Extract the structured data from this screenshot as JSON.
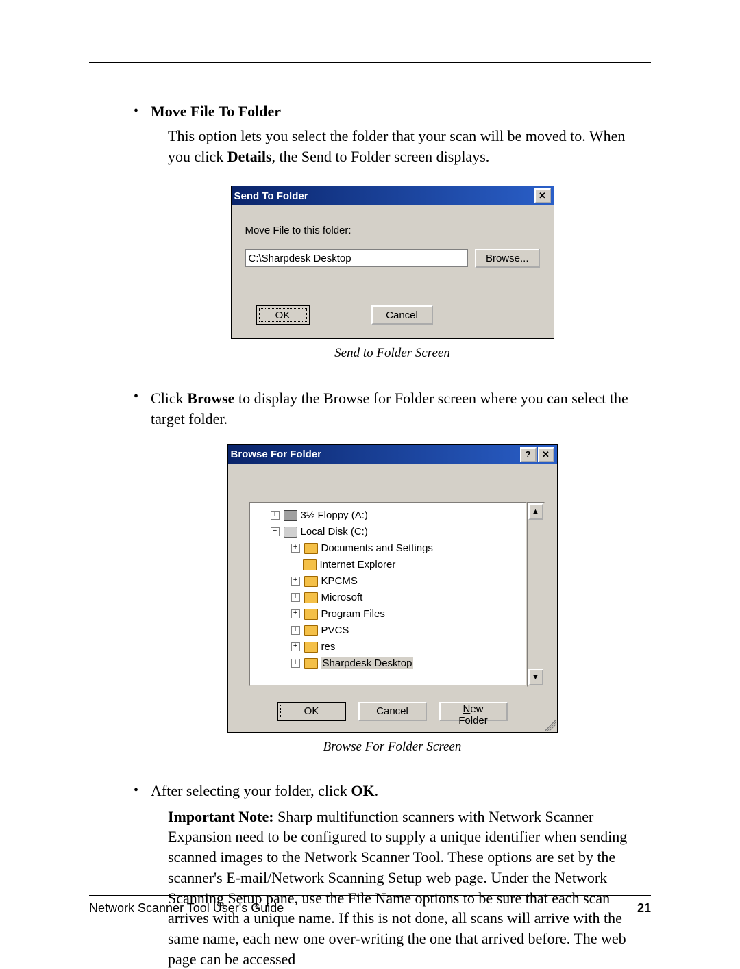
{
  "page": {
    "bullet1_heading": "Move File To Folder",
    "para1_a": "This option lets you select the folder that your scan will be moved to. When you click ",
    "para1_b_bold": "Details",
    "para1_c": ", the Send to Folder screen displays.",
    "caption1": "Send to Folder Screen",
    "bullet2_a": "Click ",
    "bullet2_b_bold": "Browse",
    "bullet2_c": " to display the Browse for Folder screen where you can select the target folder.",
    "caption2": "Browse For Folder Screen",
    "bullet3_a": "After selecting your folder, click ",
    "bullet3_b_bold": "OK",
    "bullet3_c": ".",
    "note_a_bold": "Important Note:",
    "note_b": " Sharp multifunction scanners with Network Scanner Expansion need to be configured to supply a unique identifier when sending scanned images to the Network Scanner Tool.  These options are set by the scanner's E-mail/Network Scanning Setup web page.  Under the Network Scanning Setup pane, use the File Name options to be sure that each scan arrives with a unique name.  If this is not done, all scans will arrive with the same name, each new one over-writing the one that arrived before.  The web page can be accessed"
  },
  "dlg1": {
    "title": "Send To Folder",
    "label": "Move File to this folder:",
    "path": "C:\\Sharpdesk Desktop",
    "browse": "Browse...",
    "ok": "OK",
    "cancel": "Cancel"
  },
  "dlg2": {
    "title": "Browse For Folder",
    "items": {
      "floppy": "3½ Floppy (A:)",
      "localdisk": "Local Disk (C:)",
      "docs": "Documents and Settings",
      "ie": "Internet Explorer",
      "kpcms": "KPCMS",
      "ms": "Microsoft",
      "pf": "Program Files",
      "pvcs": "PVCS",
      "res": "res",
      "sd": "Sharpdesk Desktop"
    },
    "ok": "OK",
    "cancel": "Cancel",
    "newfolder": "New Folder"
  },
  "footer": {
    "left": "Network Scanner Tool User's Guide",
    "right": "21"
  }
}
